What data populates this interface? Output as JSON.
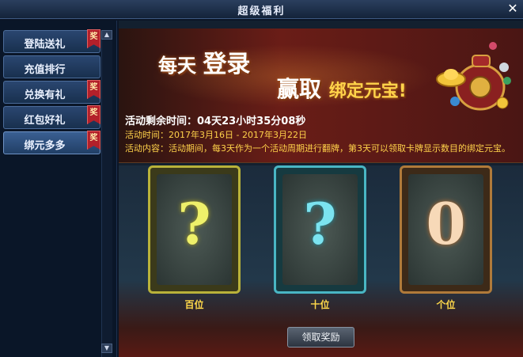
{
  "window": {
    "title": "超级福利"
  },
  "sidebar": {
    "items": [
      {
        "label": "登陆送礼",
        "badge": "奖"
      },
      {
        "label": "充值排行",
        "badge": ""
      },
      {
        "label": "兑换有礼",
        "badge": "奖"
      },
      {
        "label": "红包好礼",
        "badge": "奖"
      },
      {
        "label": "绑元多多",
        "badge": "奖",
        "active": true
      }
    ]
  },
  "banner": {
    "headline1_a": "每天",
    "headline1_b": "登录",
    "headline2_a": "赢取",
    "headline2_b": "绑定元宝!",
    "countdown": "活动剩余时间：04天23小时35分08秒",
    "time_range": "活动时间：2017年3月16日 - 2017年3月22日",
    "description": "活动内容：活动期间，每3天作为一个活动周期进行翻牌，第3天可以领取卡牌显示数目的绑定元宝。"
  },
  "cards": [
    {
      "value": "?",
      "label": "百位",
      "frame_color": "#b9b23a",
      "glyph_color": "#eef06a"
    },
    {
      "value": "?",
      "label": "十位",
      "frame_color": "#49b6c4",
      "glyph_color": "#7be3f0"
    },
    {
      "value": "0",
      "label": "个位",
      "frame_color": "#b07a3a",
      "glyph_color": "#f7d9b8"
    }
  ],
  "actions": {
    "claim_label": "领取奖励"
  },
  "colors": {
    "accent_gold": "#ffd24a",
    "banner_red": "#6a1d17",
    "badge_red": "#b3202a"
  }
}
